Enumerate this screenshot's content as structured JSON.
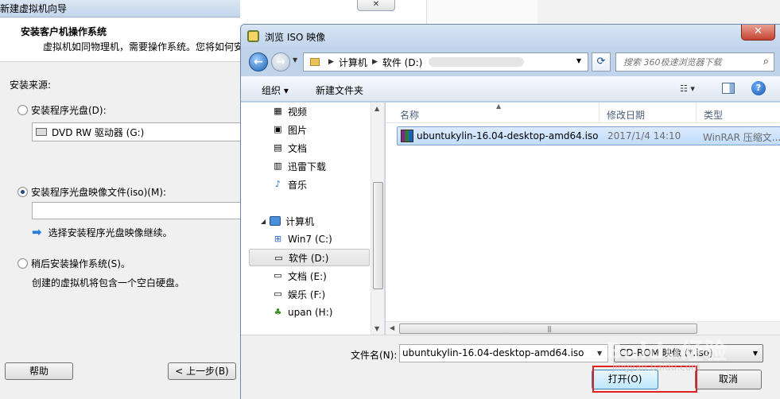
{
  "wizard": {
    "title": "新建虚拟机向导",
    "close_label": "✕",
    "header_title": "安装客户机操作系统",
    "header_desc": "虚拟机如同物理机，需要操作系统。您将如何安",
    "source_label": "安装来源:",
    "option_disc": "安装程序光盘(D):",
    "disc_drive": "DVD RW 驱动器 (G:)",
    "option_iso": "安装程序光盘映像文件(iso)(M):",
    "iso_value": "",
    "hint_text": "选择安装程序光盘映像继续。",
    "option_later": "稍后安装操作系统(S)。",
    "later_desc": "创建的虚拟机将包含一个空白硬盘。",
    "help_button": "帮助",
    "back_button": "< 上一步(B)"
  },
  "dialog": {
    "title": "浏览 ISO 映像",
    "close_label": "✕",
    "address": {
      "segments": [
        "计算机",
        "软件 (D:)"
      ]
    },
    "search_placeholder": "搜索 360极速浏览器下载",
    "toolbar": {
      "organize": "组织 ▾",
      "new_folder": "新建文件夹"
    },
    "nav_items": [
      {
        "label": "视频",
        "icon": "video-icon"
      },
      {
        "label": "图片",
        "icon": "picture-icon"
      },
      {
        "label": "文档",
        "icon": "document-icon"
      },
      {
        "label": "迅雷下载",
        "icon": "download-icon"
      },
      {
        "label": "音乐",
        "icon": "music-icon"
      }
    ],
    "computer_label": "计算机",
    "drives": [
      {
        "label": "Win7 (C:)"
      },
      {
        "label": "软件 (D:)"
      },
      {
        "label": "文档 (E:)"
      },
      {
        "label": "娱乐 (F:)"
      },
      {
        "label": "upan (H:)"
      }
    ],
    "columns": {
      "name": "名称",
      "modified": "修改日期",
      "type": "类型"
    },
    "file": {
      "name": "ubuntukylin-16.04-desktop-amd64.iso",
      "date": "2017/1/4 14:10",
      "type": "WinRAR 压缩文..."
    },
    "filename_label": "文件名(N):",
    "filename_value": "ubuntukylin-16.04-desktop-amd64.iso",
    "filetype_value": "CD-ROM 映像 (*.iso)",
    "open_button": "打开(O)",
    "cancel_button": "取消"
  },
  "watermark": {
    "text": "Baidu经验",
    "sub": "jingyan.baidu.com"
  },
  "colors": {
    "highlight_box": "#e02020",
    "selection": "#c1dcfc",
    "dialog_frame": "#bfd3ea"
  }
}
